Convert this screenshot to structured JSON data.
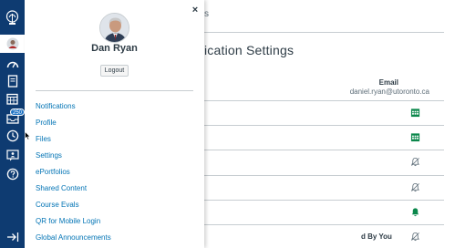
{
  "page": {
    "breadcrumb_fragment": "s",
    "title_fragment": "ication Settings",
    "email_header": "Email",
    "email_address": "daniel.ryan@utoronto.ca",
    "rows": [
      {
        "label": "",
        "icon": "calendar-icon",
        "color": "#0b874b"
      },
      {
        "label": "",
        "icon": "calendar-icon",
        "color": "#0b874b"
      },
      {
        "label": "",
        "icon": "bell-off-icon",
        "color": "#5b6b76"
      },
      {
        "label": "",
        "icon": "bell-off-icon",
        "color": "#5b6b76"
      },
      {
        "label": "",
        "icon": "bell-icon",
        "color": "#0b874b"
      },
      {
        "label": "d By You",
        "icon": "bell-off-icon",
        "color": "#5b6b76"
      }
    ]
  },
  "global_nav": {
    "items": [
      "logo-icon",
      "account-icon",
      "dashboard-icon",
      "courses-icon",
      "calendar-icon",
      "inbox-icon",
      "history-icon",
      "commons-icon",
      "help-icon",
      "collapse-icon"
    ],
    "inbox_badge": "250",
    "active_item": "account-icon",
    "color": "#0e3b71"
  },
  "tray": {
    "close_label": "×",
    "user_name": "Dan Ryan",
    "logout_label": "Logout",
    "links": [
      "Notifications",
      "Profile",
      "Files",
      "Settings",
      "ePortfolios",
      "Shared Content",
      "Course Evals",
      "QR for Mobile Login",
      "Global Announcements"
    ],
    "link_color": "#0374b5"
  }
}
